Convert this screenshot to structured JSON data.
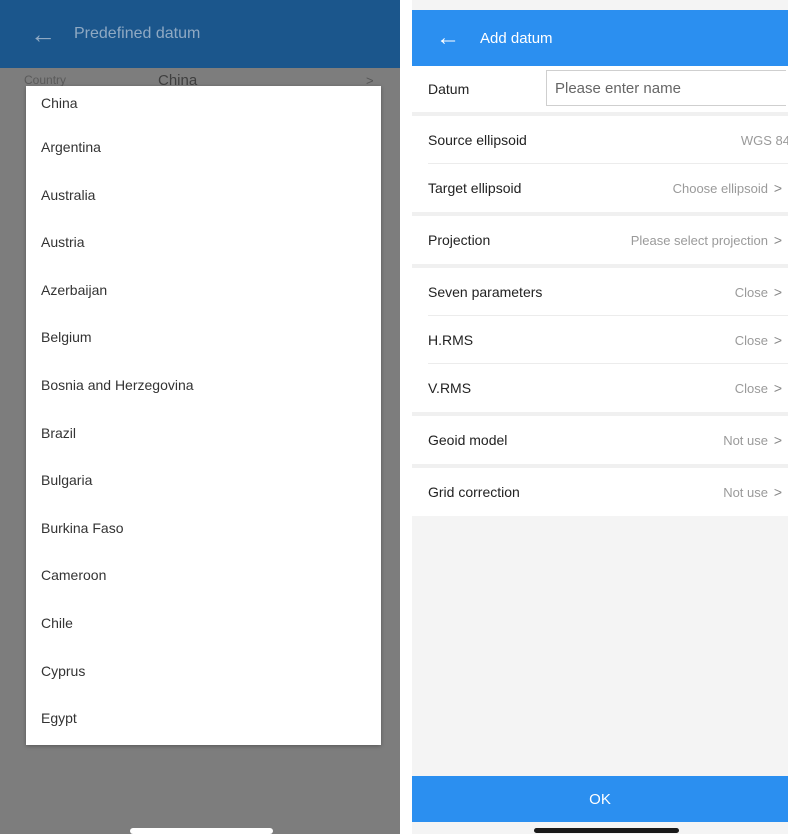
{
  "left": {
    "header_title": "Predefined datum",
    "country_label": "Country",
    "country_value": "China",
    "countries": [
      "China",
      "Argentina",
      "Australia",
      "Austria",
      "Azerbaijan",
      "Belgium",
      "Bosnia and Herzegovina",
      "Brazil",
      "Bulgaria",
      "Burkina Faso",
      "Cameroon",
      "Chile",
      "Cyprus",
      "Egypt"
    ]
  },
  "right": {
    "header_title": "Add datum",
    "datum_label": "Datum",
    "datum_placeholder": "Please enter name",
    "datum_value": "",
    "rows": [
      {
        "label": "Source ellipsoid",
        "value": "WGS 84"
      },
      {
        "label": "Target ellipsoid",
        "value": "Choose ellipsoid"
      },
      {
        "label": "Projection",
        "value": "Please select projection"
      },
      {
        "label": "Seven parameters",
        "value": "Close"
      },
      {
        "label": "H.RMS",
        "value": "Close"
      },
      {
        "label": "V.RMS",
        "value": "Close"
      },
      {
        "label": "Geoid model",
        "value": "Not use"
      },
      {
        "label": "Grid correction",
        "value": "Not use"
      }
    ],
    "ok_label": "OK"
  },
  "icons": {
    "back": "arrow-left-icon",
    "chevron": "chevron-right-icon"
  },
  "colors": {
    "primary": "#2b8ff0",
    "left_header_dim": "#1b568c",
    "overlay": "#7d7d7d"
  }
}
